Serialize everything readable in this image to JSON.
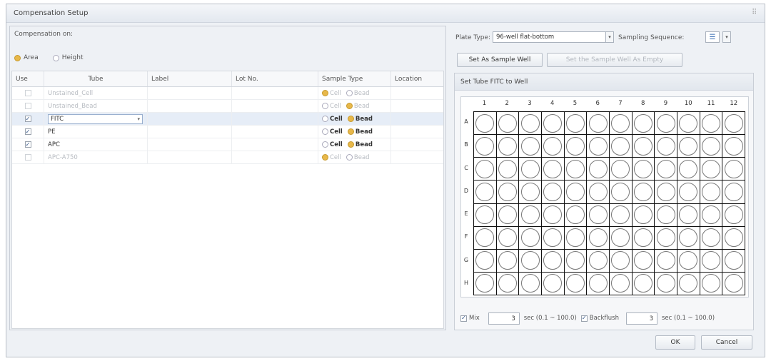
{
  "window": {
    "title": "Compensation Setup"
  },
  "compensation": {
    "label": "Compensation on:",
    "options": [
      {
        "label": "Area",
        "selected": true
      },
      {
        "label": "Height",
        "selected": false
      }
    ]
  },
  "table": {
    "headers": [
      "Use",
      "Tube",
      "Label",
      "Lot No.",
      "Sample Type",
      "Location"
    ],
    "rows": [
      {
        "use": false,
        "tube": "Unstained_Cell",
        "sample_type": "Cell",
        "enabled": false
      },
      {
        "use": false,
        "tube": "Unstained_Bead",
        "sample_type": "Bead",
        "enabled": false
      },
      {
        "use": true,
        "tube": "FITC",
        "sample_type": "Bead",
        "enabled": true,
        "selected": true
      },
      {
        "use": true,
        "tube": "PE",
        "sample_type": "Bead",
        "enabled": true
      },
      {
        "use": true,
        "tube": "APC",
        "sample_type": "Bead",
        "enabled": true
      },
      {
        "use": false,
        "tube": "APC-A750",
        "sample_type": "Cell",
        "enabled": false
      }
    ],
    "sample_type_options": {
      "cell": "Cell",
      "bead": "Bead"
    }
  },
  "plate": {
    "plate_type_label": "Plate Type:",
    "plate_type_value": "96-well flat-bottom",
    "sampling_sequence_label": "Sampling Sequence:",
    "set_sample_well": "Set As Sample Well",
    "set_empty": "Set the Sample Well As Empty",
    "panel_title": "Set Tube FITC to Well",
    "columns": [
      "1",
      "2",
      "3",
      "4",
      "5",
      "6",
      "7",
      "8",
      "9",
      "10",
      "11",
      "12"
    ],
    "rows": [
      "A",
      "B",
      "C",
      "D",
      "E",
      "F",
      "G",
      "H"
    ]
  },
  "options": {
    "mix_label": "Mix",
    "mix_checked": true,
    "mix_value": "3",
    "mix_unit": "sec (0.1 ~ 100.0)",
    "backflush_label": "Backflush",
    "backflush_checked": true,
    "backflush_value": "3",
    "backflush_unit": "sec (0.1 ~ 100.0)"
  },
  "buttons": {
    "ok": "OK",
    "cancel": "Cancel"
  },
  "colors": {
    "accent": "#e8b84a",
    "selection": "#e6edf7"
  }
}
